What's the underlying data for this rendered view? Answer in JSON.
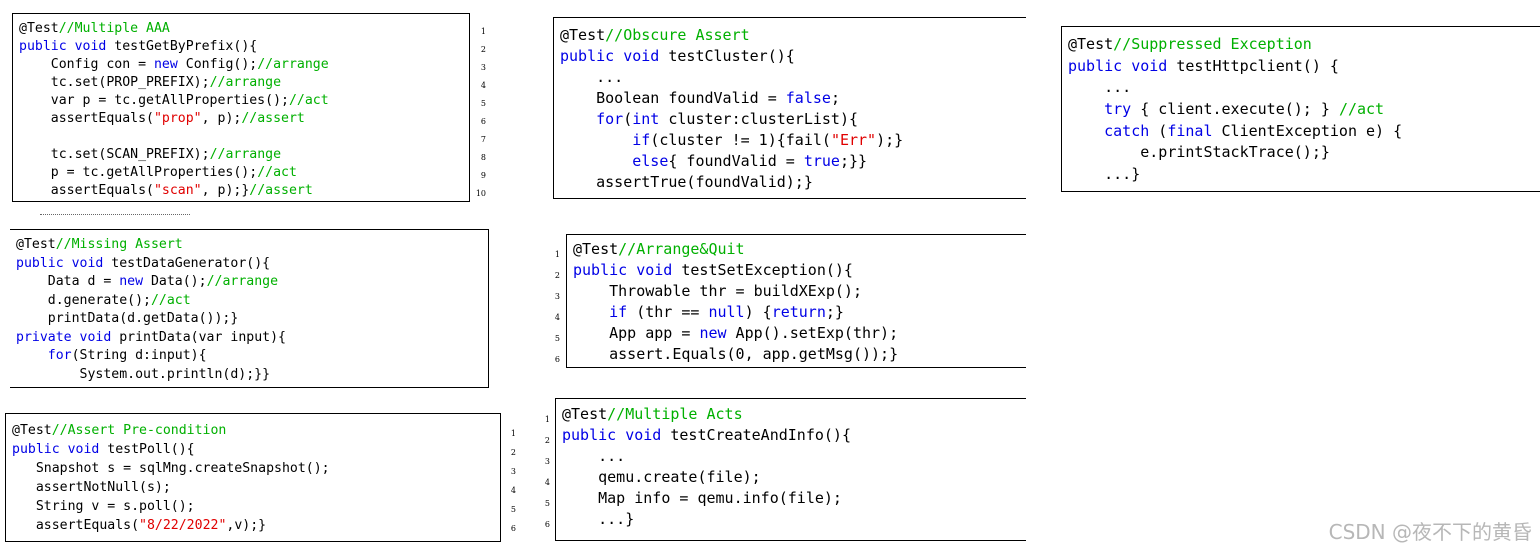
{
  "snippets": [
    {
      "id": "multiple-aaa",
      "label": "Multiple AAA",
      "lines": [
        [
          [
            "",
            "@Test"
          ],
          [
            "cm",
            "//Multiple AAA"
          ]
        ],
        [
          [
            "kw",
            "public void"
          ],
          [
            "",
            " testGetByPrefix(){"
          ]
        ],
        [
          [
            "",
            "    Config con = "
          ],
          [
            "kw",
            "new"
          ],
          [
            "",
            " Config();"
          ],
          [
            "cm",
            "//arrange"
          ]
        ],
        [
          [
            "",
            "    tc.set(PROP_PREFIX);"
          ],
          [
            "cm",
            "//arrange"
          ]
        ],
        [
          [
            "",
            "    var p = tc.getAllProperties();"
          ],
          [
            "cm",
            "//act"
          ]
        ],
        [
          [
            "",
            "    assertEquals("
          ],
          [
            "str",
            "\"prop\""
          ],
          [
            "",
            ", p);"
          ],
          [
            "cm",
            "//assert"
          ]
        ],
        [
          [
            "",
            ""
          ]
        ],
        [
          [
            "",
            "    tc.set(SCAN_PREFIX);"
          ],
          [
            "cm",
            "//arrange"
          ]
        ],
        [
          [
            "",
            "    p = tc.getAllProperties();"
          ],
          [
            "cm",
            "//act"
          ]
        ],
        [
          [
            "",
            "    assertEquals("
          ],
          [
            "str",
            "\"scan\""
          ],
          [
            "",
            ", p);}"
          ],
          [
            "cm",
            "//assert"
          ]
        ]
      ],
      "line_numbers": [
        "1",
        "2",
        "3",
        "4",
        "5",
        "6",
        "7",
        "8",
        "9",
        "10"
      ]
    },
    {
      "id": "missing-assert",
      "label": "Missing Assert",
      "lines": [
        [
          [
            "",
            "@Test"
          ],
          [
            "cm",
            "//Missing Assert"
          ]
        ],
        [
          [
            "kw",
            "public void"
          ],
          [
            "",
            " testDataGenerator(){"
          ]
        ],
        [
          [
            "",
            "    Data d = "
          ],
          [
            "kw",
            "new"
          ],
          [
            "",
            " Data();"
          ],
          [
            "cm",
            "//arrange"
          ]
        ],
        [
          [
            "",
            "    d.generate();"
          ],
          [
            "cm",
            "//act"
          ]
        ],
        [
          [
            "",
            "    printData(d.getData());}"
          ]
        ],
        [
          [
            "kw",
            "private void"
          ],
          [
            "",
            " printData(var input){"
          ]
        ],
        [
          [
            "",
            "    "
          ],
          [
            "kw",
            "for"
          ],
          [
            "",
            "(String d:input){"
          ]
        ],
        [
          [
            "",
            "        System.out.println(d);}}"
          ]
        ]
      ],
      "line_numbers": []
    },
    {
      "id": "assert-precondition",
      "label": "Assert Pre-condition",
      "lines": [
        [
          [
            "",
            "@Test"
          ],
          [
            "cm",
            "//Assert Pre-condition"
          ]
        ],
        [
          [
            "kw",
            "public void"
          ],
          [
            "",
            " testPoll(){"
          ]
        ],
        [
          [
            "",
            "   Snapshot s = sqlMng.createSnapshot();"
          ]
        ],
        [
          [
            "",
            "   assertNotNull(s);"
          ]
        ],
        [
          [
            "",
            "   String v = s.poll();"
          ]
        ],
        [
          [
            "",
            "   assertEquals("
          ],
          [
            "str",
            "\"8/22/2022\""
          ],
          [
            "",
            ",v);}"
          ]
        ]
      ],
      "line_numbers": [
        "1",
        "2",
        "3",
        "4",
        "5",
        "6"
      ]
    },
    {
      "id": "obscure-assert",
      "label": "Obscure Assert",
      "lines": [
        [
          [
            "",
            "@Test"
          ],
          [
            "cm",
            "//Obscure Assert"
          ]
        ],
        [
          [
            "kw",
            "public void"
          ],
          [
            "",
            " testCluster(){"
          ]
        ],
        [
          [
            "",
            "    ..."
          ]
        ],
        [
          [
            "",
            "    Boolean foundValid = "
          ],
          [
            "kw",
            "false"
          ],
          [
            "",
            ";"
          ]
        ],
        [
          [
            "",
            "    "
          ],
          [
            "kw",
            "for"
          ],
          [
            "",
            "("
          ],
          [
            "kw",
            "int"
          ],
          [
            "",
            " cluster:clusterList){"
          ]
        ],
        [
          [
            "",
            "        "
          ],
          [
            "kw",
            "if"
          ],
          [
            "",
            "(cluster != 1){fail("
          ],
          [
            "str",
            "\"Err\""
          ],
          [
            "",
            ");}"
          ]
        ],
        [
          [
            "",
            "        "
          ],
          [
            "kw",
            "else"
          ],
          [
            "",
            "{ foundValid = "
          ],
          [
            "kw",
            "true"
          ],
          [
            "",
            ";}}"
          ]
        ],
        [
          [
            "",
            "    assertTrue(foundValid);}"
          ]
        ]
      ],
      "line_numbers": []
    },
    {
      "id": "arrange-quit",
      "label": "Arrange&Quit",
      "lines": [
        [
          [
            "",
            "@Test"
          ],
          [
            "cm",
            "//Arrange&Quit"
          ]
        ],
        [
          [
            "kw",
            "public void"
          ],
          [
            "",
            " testSetException(){"
          ]
        ],
        [
          [
            "",
            "    Throwable thr = buildXExp();"
          ]
        ],
        [
          [
            "",
            "    "
          ],
          [
            "kw",
            "if"
          ],
          [
            "",
            " (thr == "
          ],
          [
            "kw",
            "null"
          ],
          [
            "",
            ") {"
          ],
          [
            "kw",
            "return"
          ],
          [
            "",
            ";}"
          ]
        ],
        [
          [
            "",
            "    App app = "
          ],
          [
            "kw",
            "new"
          ],
          [
            "",
            " App().setExp(thr);"
          ]
        ],
        [
          [
            "",
            "    assert.Equals(0, app.getMsg());}"
          ]
        ]
      ],
      "line_numbers": [
        "1",
        "2",
        "3",
        "4",
        "5",
        "6"
      ]
    },
    {
      "id": "multiple-acts",
      "label": "Multiple Acts",
      "lines": [
        [
          [
            "",
            "@Test"
          ],
          [
            "cm",
            "//Multiple Acts"
          ]
        ],
        [
          [
            "kw",
            "public void"
          ],
          [
            "",
            " testCreateAndInfo(){"
          ]
        ],
        [
          [
            "",
            "    ..."
          ]
        ],
        [
          [
            "",
            "    qemu.create(file);"
          ]
        ],
        [
          [
            "",
            "    Map info = qemu.info(file);"
          ]
        ],
        [
          [
            "",
            "    ...}"
          ]
        ]
      ],
      "line_numbers": [
        "1",
        "2",
        "3",
        "4",
        "5",
        "6"
      ]
    },
    {
      "id": "suppressed-exception",
      "label": "Suppressed Exception",
      "lines": [
        [
          [
            "",
            "@Test"
          ],
          [
            "cm",
            "//Suppressed Exception"
          ]
        ],
        [
          [
            "kw",
            "public void"
          ],
          [
            "",
            " testHttpclient() {"
          ]
        ],
        [
          [
            "",
            "    ..."
          ]
        ],
        [
          [
            "",
            "    "
          ],
          [
            "kw",
            "try"
          ],
          [
            "",
            " { client.execute(); } "
          ],
          [
            "cm",
            "//act"
          ]
        ],
        [
          [
            "",
            "    "
          ],
          [
            "kw",
            "catch"
          ],
          [
            "",
            " ("
          ],
          [
            "kw",
            "final"
          ],
          [
            "",
            " ClientException e) {"
          ]
        ],
        [
          [
            "",
            "        e.printStackTrace();}"
          ]
        ],
        [
          [
            "",
            "    ...}"
          ]
        ]
      ],
      "line_numbers": []
    }
  ],
  "watermark": "CSDN @夜不下的黄昏",
  "colors": {
    "keyword": "#0000e6",
    "comment": "#00b000",
    "string": "#e00000",
    "watermark": "#b7b7b7"
  }
}
